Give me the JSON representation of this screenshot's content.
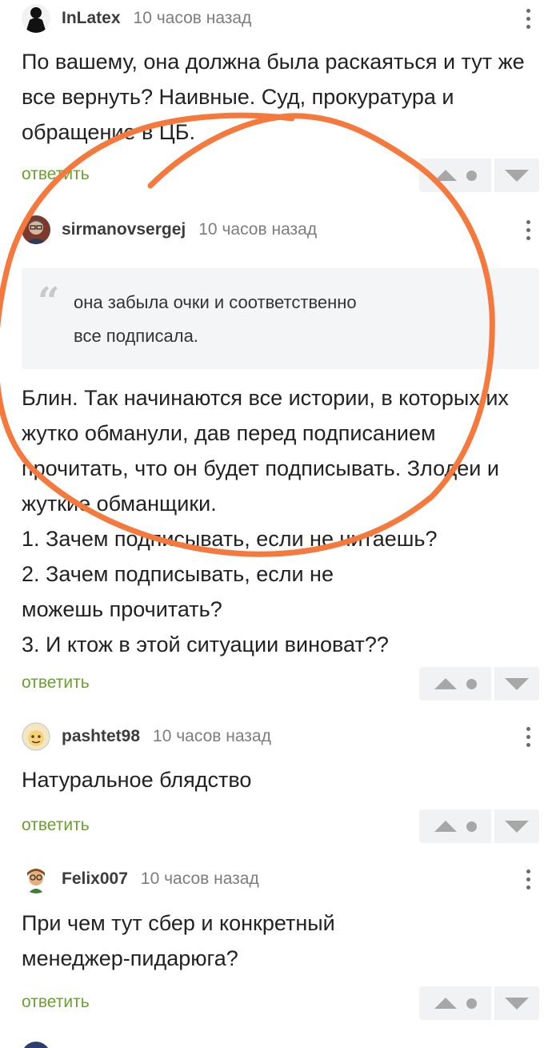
{
  "colors": {
    "reply": "#6b9f31",
    "vote_bg": "#f1f2f3",
    "vote_icon": "#a7a7a7",
    "annotation": "#f5783c"
  },
  "reply_label": "ответить",
  "comments": [
    {
      "author": "InLatex",
      "time": "10 часов назад",
      "avatar_icon": "black-figure-avatar",
      "text": "По вашему, она должна была раскаяться и тут же все вернуть? Наивные. Суд, прокуратура и обращение в ЦБ."
    },
    {
      "author": "sirmanovsergej",
      "time": "10 часов назад",
      "avatar_icon": "man-with-glasses-avatar",
      "quote": "она забыла очки и соответственно\nвсе подписала.",
      "text": "Блин. Так начинаются все истории, в которых их жутко обманули, дав перед подписанием прочитать, что он будет подписывать. Злодеи и жуткие обманщики.\n1. Зачем подписывать, если не читаешь?\n2. Зачем подписывать, если не\nможешь прочитать?\n3. И ктож в этой ситуации виноват??"
    },
    {
      "author": "pashtet98",
      "time": "10 часов назад",
      "avatar_icon": "cartoon-face-avatar",
      "text": "Натуральное блядство"
    },
    {
      "author": "Felix007",
      "time": "10 часов назад",
      "avatar_icon": "cartoon-man-avatar",
      "text": "При чем тут сбер и конкретный\nменеджер-пидарюга?"
    }
  ]
}
